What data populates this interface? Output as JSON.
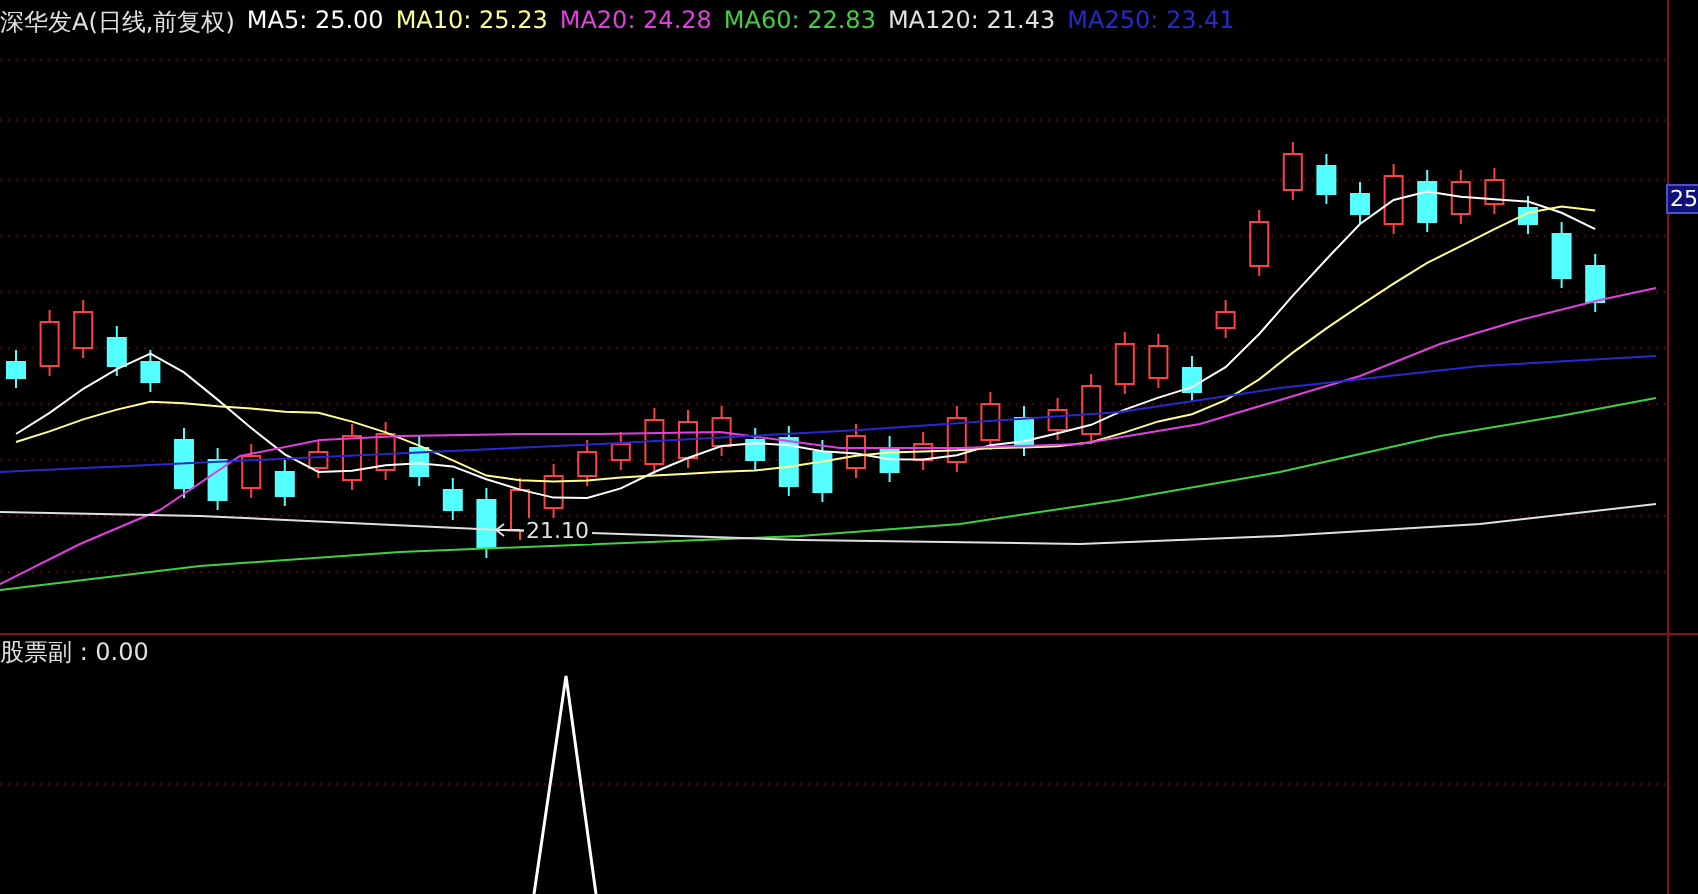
{
  "title": "深华发A(日线,前复权)",
  "ma_labels": [
    {
      "label": "MA5: 25.00",
      "color": "#ffffff"
    },
    {
      "label": "MA10: 25.23",
      "color": "#ffff90"
    },
    {
      "label": "MA20: 24.28",
      "color": "#e040e0"
    },
    {
      "label": "MA60: 22.83",
      "color": "#40d040"
    },
    {
      "label": "MA120: 21.43",
      "color": "#e0e0e0"
    },
    {
      "label": "MA250: 23.41",
      "color": "#2828d0"
    }
  ],
  "price_axis_label": "25",
  "low_marker": "21.10",
  "indicator_label": "股票副 : 0.00"
}
